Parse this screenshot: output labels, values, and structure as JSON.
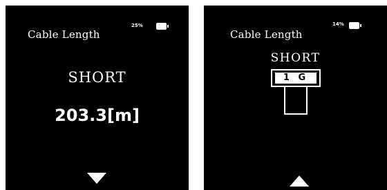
{
  "screens": [
    {
      "title": "Cable Length",
      "battery": {
        "percent_text": "25%",
        "icon": "battery-icon"
      },
      "state": "SHORT",
      "length": "203.3[m]",
      "nav": {
        "icon": "triangle-down-icon"
      }
    },
    {
      "title": "Cable Length",
      "battery": {
        "percent_text": "14%",
        "icon": "battery-icon"
      },
      "state": "SHORT",
      "port": {
        "label": "1 G",
        "icon": "ethernet-port-icon"
      },
      "nav": {
        "icon": "triangle-up-icon"
      }
    }
  ],
  "colors": {
    "screen_background": "#000000",
    "foreground": "#ffffff",
    "page_background": "#ffffff"
  }
}
